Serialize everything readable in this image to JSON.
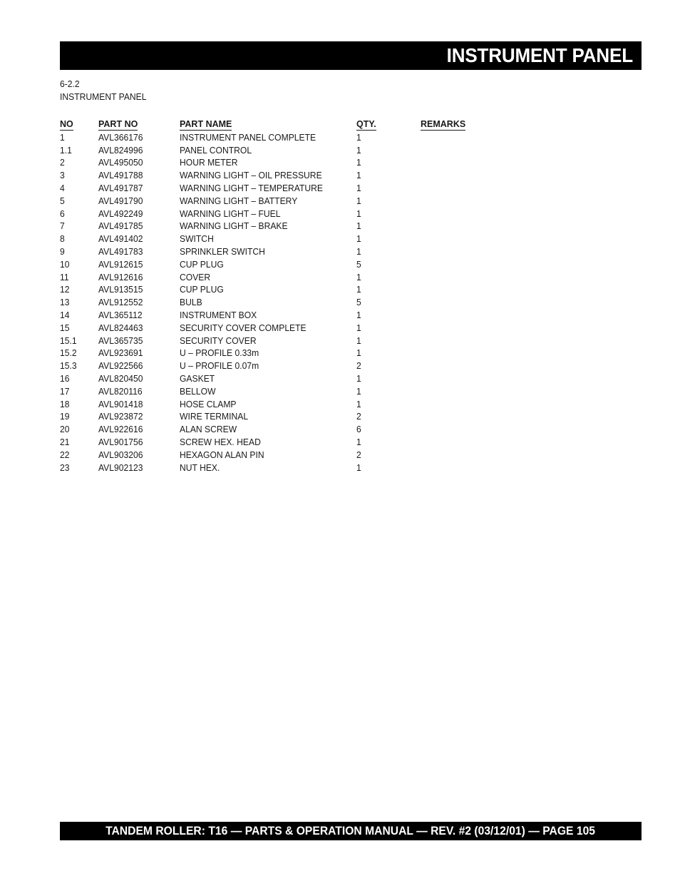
{
  "header": {
    "title": "INSTRUMENT PANEL"
  },
  "section": {
    "number": "6-2.2",
    "name": "INSTRUMENT PANEL"
  },
  "table": {
    "columns": {
      "no": "NO",
      "part_no": "PART NO",
      "part_name": "PART NAME",
      "qty": "QTY.",
      "remarks": "REMARKS"
    },
    "rows": [
      {
        "no": "1",
        "part_no": "AVL366176",
        "part_name": "INSTRUMENT PANEL COMPLETE",
        "qty": "1",
        "remarks": ""
      },
      {
        "no": "1.1",
        "part_no": "AVL824996",
        "part_name": "PANEL CONTROL",
        "qty": "1",
        "remarks": ""
      },
      {
        "no": "2",
        "part_no": "AVL495050",
        "part_name": "HOUR METER",
        "qty": "1",
        "remarks": ""
      },
      {
        "no": "3",
        "part_no": "AVL491788",
        "part_name": "WARNING LIGHT – OIL PRESSURE",
        "qty": "1",
        "remarks": ""
      },
      {
        "no": "4",
        "part_no": "AVL491787",
        "part_name": "WARNING LIGHT – TEMPERATURE",
        "qty": "1",
        "remarks": ""
      },
      {
        "no": "5",
        "part_no": "AVL491790",
        "part_name": "WARNING LIGHT – BATTERY",
        "qty": "1",
        "remarks": ""
      },
      {
        "no": "6",
        "part_no": "AVL492249",
        "part_name": "WARNING LIGHT – FUEL",
        "qty": "1",
        "remarks": ""
      },
      {
        "no": "7",
        "part_no": "AVL491785",
        "part_name": "WARNING LIGHT – BRAKE",
        "qty": "1",
        "remarks": ""
      },
      {
        "no": "8",
        "part_no": "AVL491402",
        "part_name": "SWITCH",
        "qty": "1",
        "remarks": ""
      },
      {
        "no": "9",
        "part_no": "AVL491783",
        "part_name": "SPRINKLER SWITCH",
        "qty": "1",
        "remarks": ""
      },
      {
        "no": "10",
        "part_no": "AVL912615",
        "part_name": "CUP PLUG",
        "qty": "5",
        "remarks": ""
      },
      {
        "no": "11",
        "part_no": "AVL912616",
        "part_name": "COVER",
        "qty": "1",
        "remarks": ""
      },
      {
        "no": "12",
        "part_no": "AVL913515",
        "part_name": "CUP PLUG",
        "qty": "1",
        "remarks": ""
      },
      {
        "no": "13",
        "part_no": "AVL912552",
        "part_name": "BULB",
        "qty": "5",
        "remarks": ""
      },
      {
        "no": "14",
        "part_no": "AVL365112",
        "part_name": "INSTRUMENT BOX",
        "qty": "1",
        "remarks": ""
      },
      {
        "no": "15",
        "part_no": "AVL824463",
        "part_name": "SECURITY COVER COMPLETE",
        "qty": "1",
        "remarks": ""
      },
      {
        "no": "15.1",
        "part_no": "AVL365735",
        "part_name": "SECURITY COVER",
        "qty": "1",
        "remarks": ""
      },
      {
        "no": "15.2",
        "part_no": "AVL923691",
        "part_name": "U – PROFILE 0.33m",
        "qty": "1",
        "remarks": ""
      },
      {
        "no": "15.3",
        "part_no": "AVL922566",
        "part_name": "U – PROFILE 0.07m",
        "qty": "2",
        "remarks": ""
      },
      {
        "no": "16",
        "part_no": "AVL820450",
        "part_name": "GASKET",
        "qty": "1",
        "remarks": ""
      },
      {
        "no": "17",
        "part_no": "AVL820116",
        "part_name": "BELLOW",
        "qty": "1",
        "remarks": ""
      },
      {
        "no": "18",
        "part_no": "AVL901418",
        "part_name": "HOSE CLAMP",
        "qty": "1",
        "remarks": ""
      },
      {
        "no": "19",
        "part_no": "AVL923872",
        "part_name": "WIRE TERMINAL",
        "qty": "2",
        "remarks": ""
      },
      {
        "no": "20",
        "part_no": "AVL922616",
        "part_name": "ALAN SCREW",
        "qty": "6",
        "remarks": ""
      },
      {
        "no": "21",
        "part_no": "AVL901756",
        "part_name": "SCREW HEX. HEAD",
        "qty": "1",
        "remarks": ""
      },
      {
        "no": "22",
        "part_no": "AVL903206",
        "part_name": "HEXAGON ALAN PIN",
        "qty": "2",
        "remarks": ""
      },
      {
        "no": "23",
        "part_no": "AVL902123",
        "part_name": "NUT HEX.",
        "qty": "1",
        "remarks": ""
      }
    ]
  },
  "footer": {
    "text": "TANDEM ROLLER: T16 — PARTS & OPERATION MANUAL — REV. #2 (03/12/01) — PAGE 105"
  },
  "colors": {
    "bar_background": "#000000",
    "bar_text": "#ffffff",
    "body_text": "#1a1a1a",
    "page_background": "#ffffff"
  }
}
